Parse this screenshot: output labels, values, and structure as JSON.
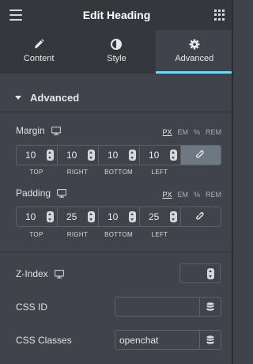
{
  "header": {
    "title": "Edit Heading",
    "menu_icon": "hamburger-menu-icon",
    "grid_icon": "apps-grid-icon"
  },
  "tabs": [
    {
      "label": "Content",
      "icon": "pencil-icon",
      "active": false
    },
    {
      "label": "Style",
      "icon": "contrast-circle-icon",
      "active": false
    },
    {
      "label": "Advanced",
      "icon": "gear-icon",
      "active": true
    }
  ],
  "section": {
    "label": "Advanced",
    "icon": "caret-down-icon"
  },
  "margin": {
    "label": "Margin",
    "units": [
      "PX",
      "EM",
      "%",
      "REM"
    ],
    "selected_unit": "PX",
    "values": [
      "10",
      "10",
      "10",
      "10"
    ],
    "sides": [
      "TOP",
      "RIGHT",
      "BOTTOM",
      "LEFT"
    ],
    "linked": true
  },
  "padding": {
    "label": "Padding",
    "units": [
      "PX",
      "EM",
      "%",
      "REM"
    ],
    "selected_unit": "PX",
    "values": [
      "10",
      "25",
      "10",
      "25"
    ],
    "sides": [
      "TOP",
      "RIGHT",
      "BOTTOM",
      "LEFT"
    ],
    "linked": false
  },
  "z_index": {
    "label": "Z-Index",
    "value": ""
  },
  "css_id": {
    "label": "CSS ID",
    "value": ""
  },
  "css_classes": {
    "label": "CSS Classes",
    "value": "openchat"
  },
  "colors": {
    "accent": "#71d7f7",
    "panel": "#404349",
    "header": "#34383c"
  }
}
